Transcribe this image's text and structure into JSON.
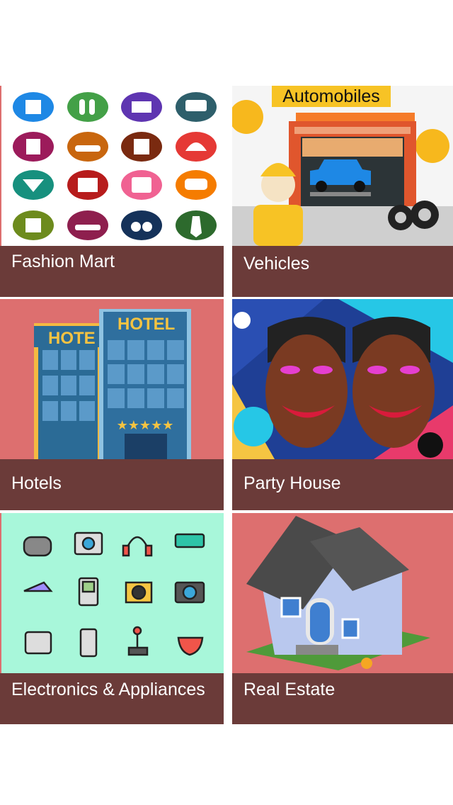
{
  "categories": [
    {
      "label": "Fashion Mart",
      "image": "fashion-icons-grid"
    },
    {
      "label": "Vehicles",
      "image": "automobiles-garage",
      "banner": "Automobiles"
    },
    {
      "label": "Hotels",
      "image": "hotel-buildings",
      "signs": [
        "HOTE",
        "HOTEL"
      ]
    },
    {
      "label": "Party House",
      "image": "party-faces"
    },
    {
      "label": "Electronics & Appliances",
      "image": "electronics-icons-grid"
    },
    {
      "label": "Real Estate",
      "image": "house-illustration"
    }
  ],
  "colors": {
    "caption_bg": "#6b3b39",
    "hotel_bg": "#dd6f6f",
    "electronics_bg": "#a8f7da"
  }
}
